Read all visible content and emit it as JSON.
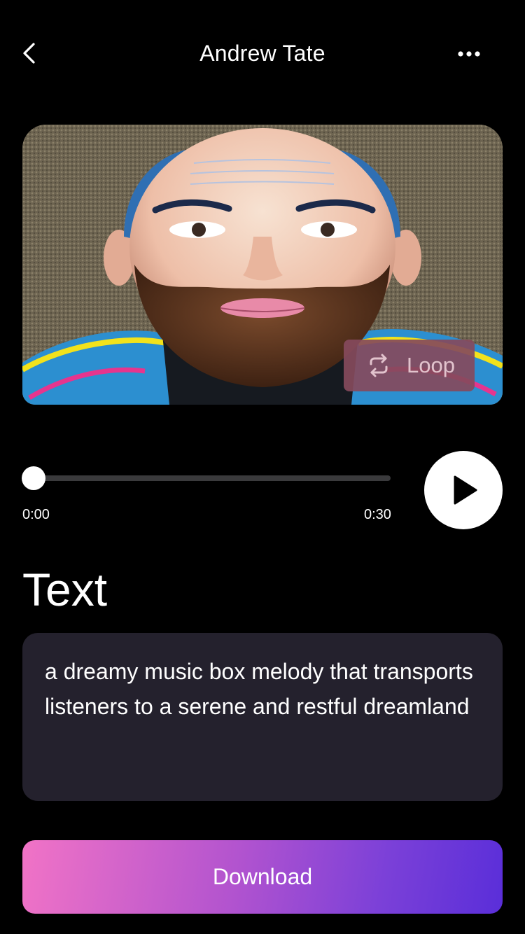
{
  "header": {
    "title": "Andrew Tate",
    "back_icon": "chevron-left-icon",
    "more_icon": "more-horizontal-icon"
  },
  "artwork": {
    "description_icon": "ai-portrait-artwork",
    "loop_label": "Loop",
    "loop_icon": "repeat-icon"
  },
  "player": {
    "current_time": "0:00",
    "duration": "0:30",
    "progress": 0.0,
    "play_icon": "play-icon"
  },
  "text_section": {
    "heading": "Text",
    "prompt": "a dreamy music box melody that transports listeners to a serene and restful dreamland"
  },
  "actions": {
    "download_label": "Download"
  },
  "colors": {
    "background": "#000000",
    "text_box": "#24212d",
    "loop_button": "#864a5c",
    "gradient_start": "#f173c6",
    "gradient_end": "#5a2ed9"
  }
}
